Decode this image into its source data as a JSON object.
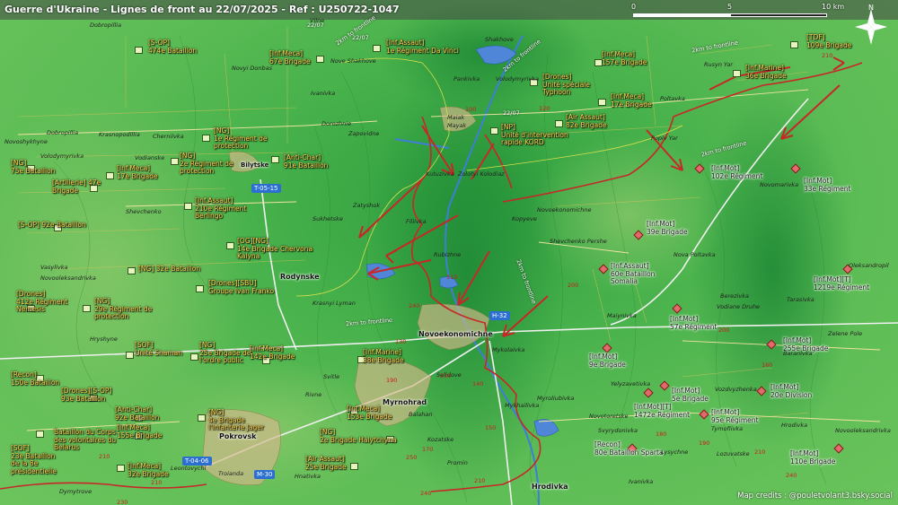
{
  "title": "Guerre d'Ukraine - Lignes de front au 22/07/2025 - Ref : U250722-1047",
  "scale": {
    "start": "0",
    "mid": "5",
    "end": "10 km"
  },
  "compass": "N",
  "credits": "Map credits : @pouletvolant3.bsky.social",
  "colors": {
    "ukraine_label": "#ffd84a",
    "front_line": "#c62828",
    "attack_arrow": "#c62828",
    "terrain": "#45b04a"
  },
  "dates": {
    "d1": "22/07",
    "d2": "22/07",
    "d3": "22/07"
  },
  "roads": {
    "r1": "T-05-15",
    "r2": "H-32",
    "r3": "T-04-06",
    "r4": "M-30"
  },
  "front_annotations": {
    "a1": "2km to frontline",
    "a2": "2km to frontline",
    "a3": "2km to frontline",
    "a4": "2km to frontline",
    "a5": "2km to frontline",
    "a6": "2km to frontline"
  },
  "ukraine_units": {
    "u01": "[S-OP]\n474e Bataillon",
    "u02": "[Inf.Meca]\n67e Brigade",
    "u03": "[Inf.Assaut]\n1e Régiment Da Vinci",
    "u04": "[Inf.Meca]\n157e Brigade",
    "u05": "[TDF]\n109e Brigade",
    "u06": "[Inf.Marine]\n36e Brigade",
    "u07": "[Drones]\nUnité spéciale\nTyphoon",
    "u08": "[Inf.Meca]\n17e Brigade",
    "u09": "[Air Assaut]\n82e Brigade",
    "u10": "[NP]\nUnité d'intervention\nrapide KORD",
    "u11": "[NG]\n1e Régiment de\nprotection",
    "u12": "[NG]\n2e Régiment de\nprotection",
    "u13": "[Anti-Char]\n91e Bataillon",
    "u14": "[NG]\n75e Bataillon",
    "u15": "[Artillerie] 47e\nBrigade",
    "u16": "[Inf.Meca]\n17e Brigade",
    "u17": "[Inf.Assaut]\n210e Régiment\nBerlingo",
    "u18": "[S-OP] 92e Bataillon",
    "u19": "[OG][NG]\n14e Brigade Chervona\nKalyna",
    "u20": "[NG] 32e Bataillon",
    "u21": "[Drones][SBU]\nGroupe Ivan Franko",
    "u22": "[Drones]\n412e Régiment\nNemesis",
    "u23": "[NG]\n29e Régiment de\nprotection",
    "u24": "[SOF]\nUnité Shaman",
    "u25": "[NG]\n25e Brigade de\nl'ordre public",
    "u26": "[Inf.Meca]\n142e Brigade",
    "u27": "[Inf.Marine]\n38e Brigade",
    "u28": "[Recon]\n150e Bataillon",
    "u29": "[Drones][S-OP]\n93e Bataillon",
    "u30": "[Anti-Char]\n92e Bataillon",
    "u31": "[Inf.Meca]\n155e Brigade",
    "u32": "[NG]\n4e Brigade\nl'infanterie Jager",
    "u33": "[Inf.Meca]\n153e Brigade",
    "u34": "[NG]\n2e Brigade Halytchyna",
    "u35": "Bataillon du Corps\ndes volontaires du\nBelarus",
    "u36": "[SOF]\n23e Bataillon\nde la 8e\nprésidentielle",
    "u37": "[Inf.Meca]\n32e Brigade",
    "u38": "[Air Assaut]\n25e Brigade"
  },
  "russia_units": {
    "r01": "[Inf.Mot]\n102e Régiment",
    "r02": "[Inf.Mot]\n33e Régiment",
    "r03": "[Inf.Mot]\n39e Brigade",
    "r04": "[Inf.Assaut]\n60e Bataillon\nSomalia",
    "r05": "[Inf.Mot][T]\n1219e Régiment",
    "r06": "[Inf.Mot]\n57e Régiment",
    "r07": "[Inf.Mot]\n255e Brigade",
    "r08": "[Inf.Mot]\n9e Brigade",
    "r09": "[Inf.Mot][T]\n1472e Régiment",
    "r10": "[Inf.Mot]\n5e Brigade",
    "r11": "[Inf.Mot]\n95e Régiment",
    "r12": "[Inf.Mot]\n20e Division",
    "r13": "[Recon]\n80e Bataillon Sparta",
    "r14": "[Inf.Mot]\n110e Brigade"
  },
  "places": {
    "p01": "Dobropillia",
    "p02": "Novyi Donbas",
    "p03": "Nove Shakhove",
    "p04": "Ivanivka",
    "p05": "Vilne",
    "p06": "Shakhove",
    "p07": "Pankivka",
    "p08": "Volodymyrivka",
    "p09": "Rusyn Yar",
    "p10": "Poltavka",
    "p11": "Popiv Yar",
    "p12": "Maiak",
    "p13": "Zapovidne",
    "p14": "Dorozhnie",
    "p15": "Krasnopodillia",
    "p16": "Novoshykhyne",
    "p17": "Cherniivka",
    "p18": "Dobropillia",
    "p19": "Vodianske",
    "p20": "Bilytske",
    "p21": "Sukhetske",
    "p22": "Zatyshok",
    "p23": "Filiivka",
    "p24": "Kutuzivka",
    "p25": "Shevchenko",
    "p26": "Kopyeve",
    "p27": "Nova Poltavka",
    "p28": "Volodymyrivka",
    "p29": "Zolotyi Kolodiaz",
    "p30": "Mayak",
    "p31": "Novomarivka",
    "p32": "Shevchenko Pershe",
    "p33": "Rubizhne",
    "p34": "Berezivka",
    "p35": "Vodiane Druhe",
    "p36": "Tarasivka",
    "p37": "Oleksandropil",
    "p38": "Zelene Pole",
    "p39": "Maiynivka",
    "p40": "Mykolaivka",
    "p41": "Krasnyi Lyman",
    "p42": "Novooleksandrivka",
    "p43": "Vasylivka",
    "p44": "Hryshyne",
    "p45": "Svitle",
    "p46": "Rivne",
    "p47": "Selidove",
    "p48": "Balahan",
    "p49": "Kozatske",
    "p50": "Yelyzavetivka",
    "p51": "Mykhailivka",
    "p52": "Myroliubivka",
    "p53": "Novotoretske",
    "p54": "Svyrydonivka",
    "p55": "Vozdvyzhenka",
    "p56": "Tymofiivka",
    "p57": "Promin",
    "p58": "Lysychne",
    "p59": "Hrodivka",
    "p60": "Ivanivka",
    "p61": "Lozuvatske",
    "p62": "Novooleksandrivka",
    "p63": "Leontovychi",
    "p64": "Troianda",
    "p65": "Dymytrove",
    "p66": "Hnativka",
    "p67": "Baranivka",
    "p68": "Novoekonomichne"
  },
  "towns": {
    "t1": "Rodynske",
    "t2": "Novoekonomichne",
    "t3": "Myrnohrad",
    "t4": "Pokrovsk",
    "t5": "Hrodivka"
  },
  "altitudes": {
    "h1": "210",
    "h2": "210",
    "h3": "240",
    "h4": "210",
    "h5": "190",
    "h6": "210",
    "h7": "250",
    "h8": "240",
    "h9": "210",
    "h10": "180",
    "h11": "200",
    "h12": "160",
    "h13": "240",
    "h14": "210",
    "h15": "120",
    "h16": "100",
    "h17": "110",
    "h18": "130",
    "h19": "140",
    "h20": "150",
    "h21": "170",
    "h22": "200",
    "h23": "190",
    "h24": "230"
  }
}
